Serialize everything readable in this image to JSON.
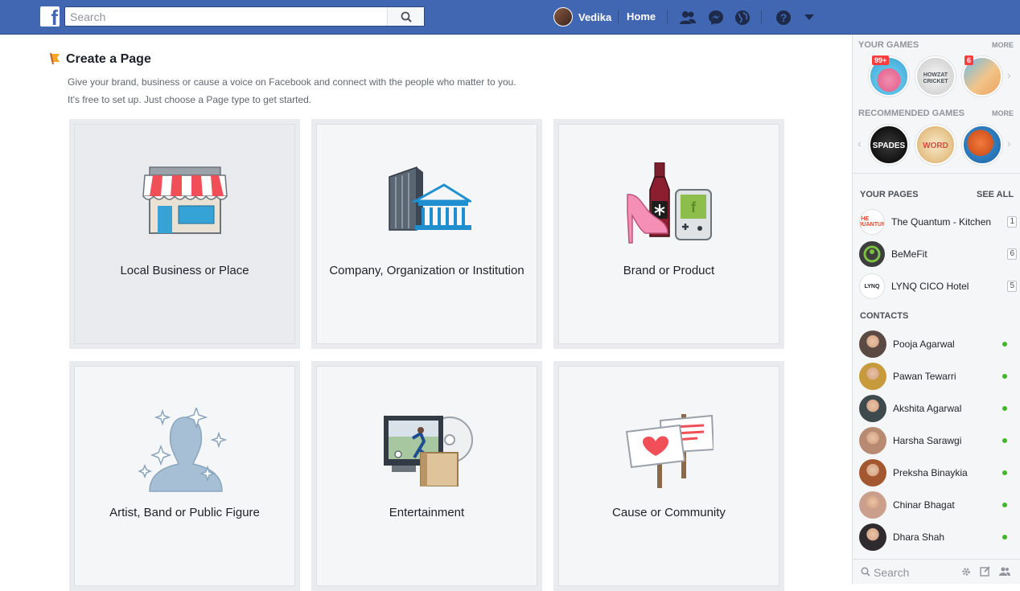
{
  "topbar": {
    "logo": "f",
    "search_placeholder": "Search",
    "user_name": "Vedika",
    "home": "Home"
  },
  "main": {
    "title": "Create a Page",
    "subtitle_line1": "Give your brand, business or cause a voice on Facebook and connect with the people who matter to you.",
    "subtitle_line2": "It's free to set up. Just choose a Page type to get started.",
    "cards": [
      {
        "label": "Local Business or Place",
        "icon": "storefront-icon"
      },
      {
        "label": "Company, Organization or Institution",
        "icon": "office-buildings-icon"
      },
      {
        "label": "Brand or Product",
        "icon": "brand-products-icon"
      },
      {
        "label": "Artist, Band or Public Figure",
        "icon": "public-figure-icon"
      },
      {
        "label": "Entertainment",
        "icon": "entertainment-icon"
      },
      {
        "label": "Cause or Community",
        "icon": "protest-signs-icon"
      }
    ]
  },
  "sidebar": {
    "your_games": "YOUR GAMES",
    "recommended_games": "RECOMMENDED GAMES",
    "more": "MORE",
    "game_badges": [
      "99+",
      "6"
    ],
    "game_labels": [
      "HOWZAT CRICKET",
      "SPADES",
      "WORD"
    ],
    "your_pages": "YOUR PAGES",
    "see_all": "SEE ALL",
    "pages": [
      {
        "name": "The Quantum - Kitchen",
        "count": "1",
        "thumb": "THE QUANTUM"
      },
      {
        "name": "BeMeFit",
        "count": "6",
        "thumb": ""
      },
      {
        "name": "LYNQ CICO Hotel",
        "count": "5",
        "thumb": "LYNQ"
      }
    ],
    "contacts_header": "CONTACTS",
    "contacts": [
      {
        "name": "Pooja Agarwal",
        "color": "#5b4a44"
      },
      {
        "name": "Pawan Tewarri",
        "color": "#c79a3c"
      },
      {
        "name": "Akshita Agarwal",
        "color": "#3f4a4f"
      },
      {
        "name": "Harsha Sarawgi",
        "color": "#b88a72"
      },
      {
        "name": "Preksha Binaykia",
        "color": "#a3582f"
      },
      {
        "name": "Chinar Bhagat",
        "color": "#caa08c"
      },
      {
        "name": "Dhara Shah",
        "color": "#2e2a2d"
      }
    ],
    "search_placeholder": "Search"
  },
  "colors": {
    "brand": "#4267b2",
    "online": "#42b72a",
    "badge": "#fa3e3e"
  }
}
